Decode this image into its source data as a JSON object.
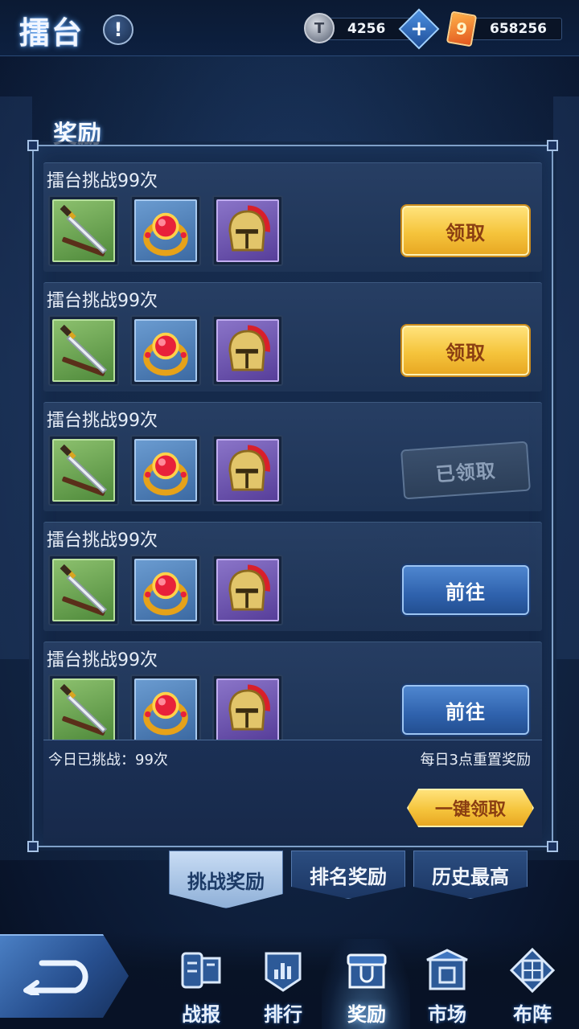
{
  "header": {
    "title": "擂台",
    "info_glyph": "!",
    "currency1": {
      "icon": "coin-icon",
      "glyph": "T",
      "value": "4256"
    },
    "plus_glyph": "+",
    "currency2": {
      "icon": "ticket-icon",
      "glyph": "9",
      "value": "658256"
    }
  },
  "panel": {
    "title": "奖励",
    "rows": [
      {
        "title": "擂台挑战99次",
        "items": [
          "sword-icon",
          "ruby-ring-icon",
          "helmet-icon"
        ],
        "button": "领取",
        "state": "claim"
      },
      {
        "title": "擂台挑战99次",
        "items": [
          "sword-icon",
          "ruby-ring-icon",
          "helmet-icon"
        ],
        "button": "领取",
        "state": "claim"
      },
      {
        "title": "擂台挑战99次",
        "items": [
          "sword-icon",
          "ruby-ring-icon",
          "helmet-icon"
        ],
        "button": "已领取",
        "state": "claimed"
      },
      {
        "title": "擂台挑战99次",
        "items": [
          "sword-icon",
          "ruby-ring-icon",
          "helmet-icon"
        ],
        "button": "前往",
        "state": "goto"
      },
      {
        "title": "擂台挑战99次",
        "items": [
          "sword-icon",
          "ruby-ring-icon",
          "helmet-icon"
        ],
        "button": "前往",
        "state": "goto"
      }
    ],
    "footer_left": "今日已挑战：99次",
    "footer_right": "每日3点重置奖励",
    "claim_all": "一键领取"
  },
  "subtabs": [
    {
      "label": "挑战奖励",
      "active": true
    },
    {
      "label": "排名奖励",
      "active": false
    },
    {
      "label": "历史最高",
      "active": false
    }
  ],
  "nav": [
    {
      "label": "战报",
      "icon": "battle-report-icon",
      "active": false
    },
    {
      "label": "排行",
      "icon": "ranking-icon",
      "active": false
    },
    {
      "label": "奖励",
      "icon": "reward-chest-icon",
      "active": true
    },
    {
      "label": "市场",
      "icon": "market-icon",
      "active": false
    },
    {
      "label": "布阵",
      "icon": "formation-icon",
      "active": false
    }
  ],
  "colors": {
    "gold_button": "#f5c43c",
    "blue_button": "#2f62ad",
    "panel_bg": "#17294a",
    "item_green": "#6ea556",
    "item_blue": "#4f7fba",
    "item_purple": "#6d58b0"
  }
}
